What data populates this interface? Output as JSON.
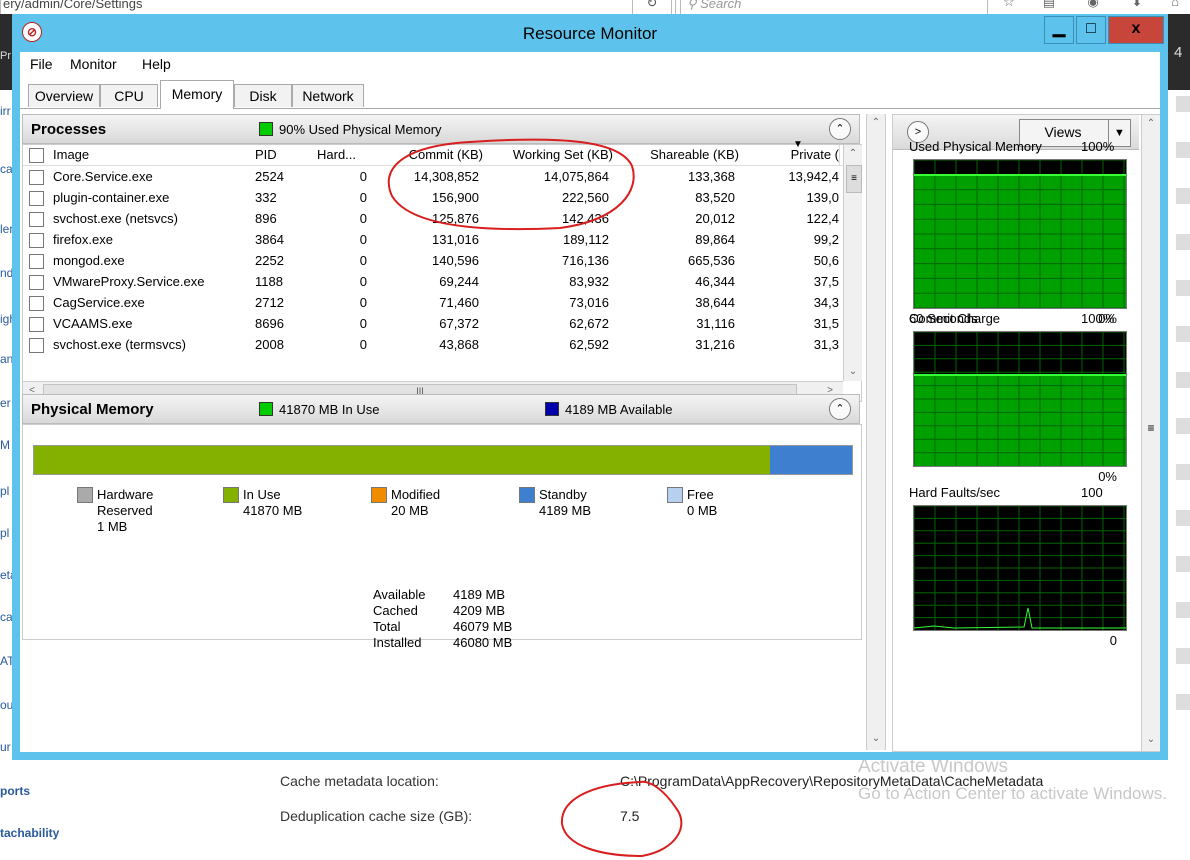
{
  "browser": {
    "url_fragment": "ery/admin/Core/Settings",
    "search_placeholder": "Search",
    "left_dark_text": "Pr",
    "right_dark_text": "4",
    "side_fragments": [
      "irr",
      "cac",
      "len",
      "nd",
      "igh",
      "an",
      "er",
      "M",
      "pl",
      "pl",
      "eta",
      "ca",
      "AT",
      "ou",
      "ur"
    ],
    "bottom_links": [
      "ports",
      "tachability"
    ],
    "settings": [
      {
        "label": "Cache metadata location:",
        "value": "C:\\ProgramData\\AppRecovery\\RepositoryMetaData\\CacheMetadata"
      },
      {
        "label": "Deduplication cache size (GB):",
        "value": "7.5"
      }
    ],
    "watermark_line1": "Activate Windows",
    "watermark_line2": "Go to Action Center to activate Windows."
  },
  "window": {
    "title": "Resource Monitor",
    "close_label": "x",
    "menu": [
      "File",
      "Monitor",
      "Help"
    ],
    "tabs": [
      {
        "label": "Overview",
        "active": false
      },
      {
        "label": "CPU",
        "active": false
      },
      {
        "label": "Memory",
        "active": true
      },
      {
        "label": "Disk",
        "active": false
      },
      {
        "label": "Network",
        "active": false
      }
    ]
  },
  "processes": {
    "title": "Processes",
    "status": "90% Used Physical Memory",
    "status_color": "#00cc00",
    "columns": [
      "Image",
      "PID",
      "Hard...",
      "Commit (KB)",
      "Working Set (KB)",
      "Shareable (KB)",
      "Private ("
    ],
    "rows": [
      [
        "Core.Service.exe",
        "2524",
        "0",
        "14,308,852",
        "14,075,864",
        "133,368",
        "13,942,4"
      ],
      [
        "plugin-container.exe",
        "332",
        "0",
        "156,900",
        "222,560",
        "83,520",
        "139,0"
      ],
      [
        "svchost.exe (netsvcs)",
        "896",
        "0",
        "125,876",
        "142,436",
        "20,012",
        "122,4"
      ],
      [
        "firefox.exe",
        "3864",
        "0",
        "131,016",
        "189,112",
        "89,864",
        "99,2"
      ],
      [
        "mongod.exe",
        "2252",
        "0",
        "140,596",
        "716,136",
        "665,536",
        "50,6"
      ],
      [
        "VMwareProxy.Service.exe",
        "1188",
        "0",
        "69,244",
        "83,932",
        "46,344",
        "37,5"
      ],
      [
        "CagService.exe",
        "2712",
        "0",
        "71,460",
        "73,016",
        "38,644",
        "34,3"
      ],
      [
        "VCAAMS.exe",
        "8696",
        "0",
        "67,372",
        "62,672",
        "31,116",
        "31,5"
      ],
      [
        "svchost.exe (termsvcs)",
        "2008",
        "0",
        "43,868",
        "62,592",
        "31,216",
        "31,3"
      ]
    ],
    "hscroll_thumb": "III"
  },
  "physical_memory": {
    "title": "Physical Memory",
    "in_use_text": "41870 MB In Use",
    "in_use_color": "#00cc00",
    "available_text": "4189 MB Available",
    "available_color": "#0000aa",
    "bar_in_use_fraction": 0.9,
    "bar_in_use_color": "#84b000",
    "bar_standby_color": "#3f7fd0",
    "legend": [
      {
        "line1": "Hardware",
        "line2": "Reserved",
        "line3": "1 MB",
        "color": "#aaaaaa"
      },
      {
        "line1": "In Use",
        "line2": "41870 MB",
        "line3": "",
        "color": "#84b000"
      },
      {
        "line1": "Modified",
        "line2": "20 MB",
        "line3": "",
        "color": "#f08c00"
      },
      {
        "line1": "Standby",
        "line2": "4189 MB",
        "line3": "",
        "color": "#3f7fd0"
      },
      {
        "line1": "Free",
        "line2": "0 MB",
        "line3": "",
        "color": "#b8d0f0"
      }
    ],
    "summary": [
      {
        "label": "Available",
        "value": "4189 MB"
      },
      {
        "label": "Cached",
        "value": "4209 MB"
      },
      {
        "label": "Total",
        "value": "46079 MB"
      },
      {
        "label": "Installed",
        "value": "46080 MB"
      }
    ]
  },
  "views": {
    "label": "Views",
    "graphs": [
      {
        "title": "Used Physical Memory",
        "max": "100%",
        "footer_left": "60 Seconds",
        "footer_right": "0%",
        "fill": 0.9
      },
      {
        "title": "Commit Charge",
        "max": "100%",
        "footer_left": "",
        "footer_right": "0%",
        "fill": 0.68
      },
      {
        "title": "Hard Faults/sec",
        "max": "100",
        "footer_left": "",
        "footer_right": "0",
        "fill": 0
      }
    ]
  }
}
